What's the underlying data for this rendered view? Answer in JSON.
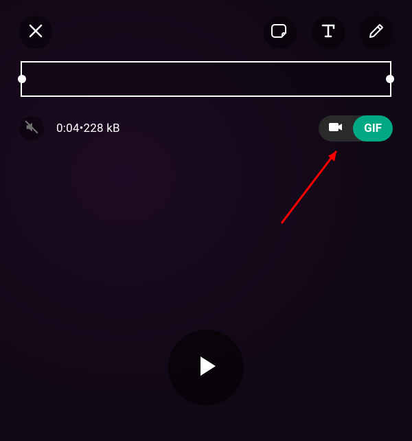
{
  "topbar": {
    "close_icon": "close-icon",
    "sticker_icon": "sticker-icon",
    "text_icon": "text-icon",
    "draw_icon": "pencil-icon"
  },
  "info": {
    "duration": "0:04",
    "separator": "  •  ",
    "filesize": "228 kB"
  },
  "toggle": {
    "gif_label": "GIF"
  },
  "colors": {
    "accent": "#00a884",
    "annotation": "#ff0000"
  }
}
